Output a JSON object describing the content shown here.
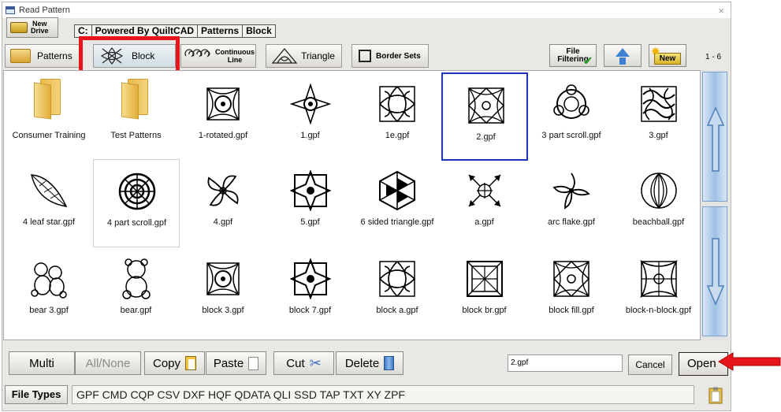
{
  "window": {
    "title": "Read Pattern",
    "close_glyph": "×"
  },
  "drive_button": {
    "line1": "New",
    "line2": "Drive"
  },
  "path": [
    "C:",
    "Powered By QuiltCAD",
    "Patterns",
    "Block"
  ],
  "tabs": {
    "patterns": "Patterns",
    "block": "Block",
    "continuous_line_1": "Continuous",
    "continuous_line_2": "Line",
    "triangle": "Triangle",
    "border_sets": "Border Sets"
  },
  "toolbar": {
    "file_filtering_1": "File",
    "file_filtering_2": "Filtering",
    "new_label": "New",
    "page_range": "1 - 6"
  },
  "files": [
    {
      "name": "Consumer Training",
      "type": "folder"
    },
    {
      "name": "Test Patterns",
      "type": "folder"
    },
    {
      "name": "1-rotated.gpf",
      "type": "pattern",
      "icon": "knot-block-icon"
    },
    {
      "name": "1.gpf",
      "type": "pattern",
      "icon": "cross-motif-icon"
    },
    {
      "name": "1e.gpf",
      "type": "pattern",
      "icon": "swirl-square-icon"
    },
    {
      "name": "2.gpf",
      "type": "pattern",
      "icon": "diamond-square-icon",
      "selected": true
    },
    {
      "name": "3 part scroll.gpf",
      "type": "pattern",
      "icon": "scroll-ring-icon"
    },
    {
      "name": "3.gpf",
      "type": "pattern",
      "icon": "dense-swirl-icon"
    },
    {
      "name": "4 leaf star.gpf",
      "type": "pattern",
      "icon": "leaf-icon"
    },
    {
      "name": "4 part scroll.gpf",
      "type": "pattern",
      "icon": "medallion-icon",
      "hover": true
    },
    {
      "name": "4.gpf",
      "type": "pattern",
      "icon": "pinwheel-icon"
    },
    {
      "name": "5.gpf",
      "type": "pattern",
      "icon": "star-frame-icon"
    },
    {
      "name": "6 sided triangle.gpf",
      "type": "pattern",
      "icon": "hexagon-icon"
    },
    {
      "name": "a.gpf",
      "type": "pattern",
      "icon": "arrow-star-icon"
    },
    {
      "name": "arc flake.gpf",
      "type": "pattern",
      "icon": "arc-flake-icon"
    },
    {
      "name": "beachball.gpf",
      "type": "pattern",
      "icon": "beachball-icon"
    },
    {
      "name": "bear 3.gpf",
      "type": "pattern",
      "icon": "bears-icon"
    },
    {
      "name": "bear.gpf",
      "type": "pattern",
      "icon": "bear-icon"
    },
    {
      "name": "block 3.gpf",
      "type": "pattern",
      "icon": "knot-block-icon"
    },
    {
      "name": "block 7.gpf",
      "type": "pattern",
      "icon": "star-frame-icon"
    },
    {
      "name": "block a.gpf",
      "type": "pattern",
      "icon": "swirl-square-icon"
    },
    {
      "name": "block br.gpf",
      "type": "pattern",
      "icon": "framed-square-icon"
    },
    {
      "name": "block fill.gpf",
      "type": "pattern",
      "icon": "diamond-square-icon"
    },
    {
      "name": "block-n-block.gpf",
      "type": "pattern",
      "icon": "curved-square-icon"
    }
  ],
  "actions": {
    "multi": "Multi",
    "all_none": "All/None",
    "copy": "Copy",
    "paste": "Paste",
    "cut": "Cut",
    "delete": "Delete"
  },
  "filename_value": "2.gpf",
  "cancel": "Cancel",
  "open": "Open",
  "file_types": {
    "label": "File Types",
    "list": "GPF  CMD  CQP  CSV  DXF  HQF  QDATA  QLI  SSD  TAP  TXT  XY  ZPF"
  },
  "colors": {
    "highlight_red": "#e6151b",
    "selection_blue": "#2233bb",
    "scroll_blue": "#9fc0e4"
  }
}
